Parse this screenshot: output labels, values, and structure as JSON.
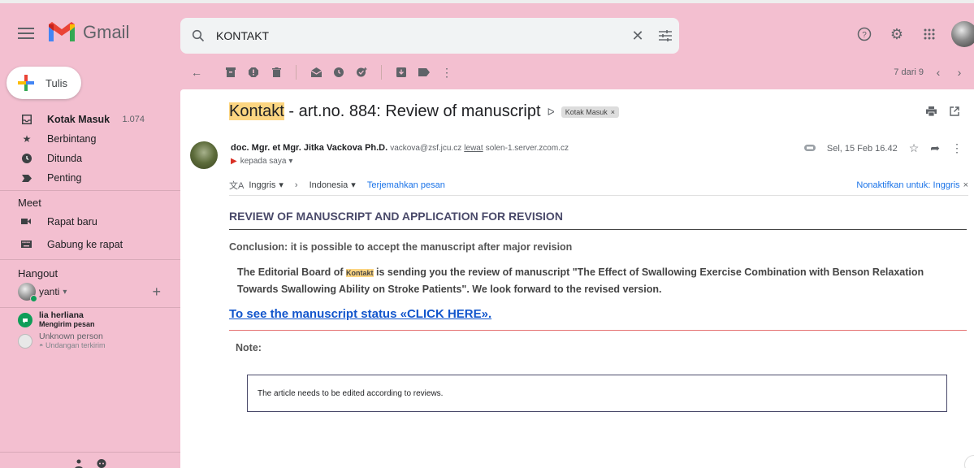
{
  "app": {
    "name": "Gmail"
  },
  "search": {
    "value": "KONTAKT"
  },
  "sidebar": {
    "compose": "Tulis",
    "items": [
      {
        "label": "Kotak Masuk",
        "count": "1.074",
        "icon": "inbox-icon"
      },
      {
        "label": "Berbintang",
        "icon": "star-icon"
      },
      {
        "label": "Ditunda",
        "icon": "clock-icon"
      },
      {
        "label": "Penting",
        "icon": "important-icon"
      }
    ],
    "meet": {
      "title": "Meet",
      "new": "Rapat baru",
      "join": "Gabung ke rapat"
    },
    "hangout": {
      "title": "Hangout",
      "user": "yanti",
      "contacts": [
        {
          "name": "lia herliana",
          "sub": "Mengirim pesan"
        },
        {
          "name": "Unknown person",
          "sub": "Undangan terkirim"
        }
      ]
    }
  },
  "toolbar": {
    "pagination": "7 dari 9"
  },
  "message": {
    "subject_highlight": "Kontakt",
    "subject_rest": " - art.no. 884: Review of manuscript",
    "label_chip": "Kotak Masuk",
    "sender_name": "doc. Mgr. et Mgr. Jitka Vackova Ph.D.",
    "sender_email": "vackova@zsf.jcu.cz",
    "via_label": "lewat",
    "via_server": "solen-1.server.zcom.cz",
    "to": "kepada saya",
    "date": "Sel, 15 Feb 16.42",
    "translate": {
      "from": "Inggris",
      "to": "Indonesia",
      "action": "Terjemahkan pesan",
      "disable": "Nonaktifkan untuk: Inggris"
    },
    "body": {
      "heading": "REVIEW OF MANUSCRIPT AND APPLICATION FOR REVISION",
      "conclusion": "Conclusion: it is possible to accept the manuscript after major revision",
      "para_start": "The Editorial Board of",
      "para_journal": "Kontakt",
      "para_end": "is sending you the review of manuscript \"The Effect of Swallowing Exercise Combination with Benson Relaxation Towards Swallowing Ability on Stroke Patients\". We look forward to the revised version.",
      "link": "To see the manuscript status «CLICK HERE».",
      "note_label": "Note:",
      "note_text": "The article needs to be edited according to reviews."
    }
  },
  "colors": {
    "background": "#f3bfd0",
    "link": "#1155cc",
    "highlight": "#fcd581"
  }
}
